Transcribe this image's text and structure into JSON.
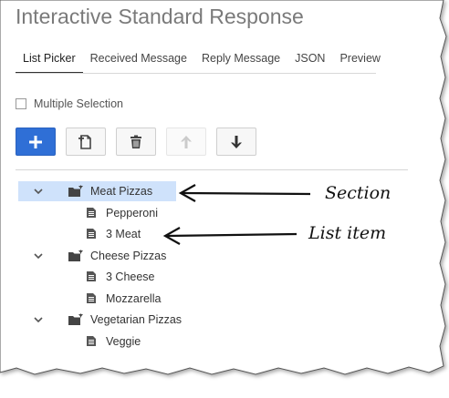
{
  "title": "Interactive Standard Response",
  "tabs": [
    "List Picker",
    "Received Message",
    "Reply Message",
    "JSON",
    "Preview"
  ],
  "active_tab": "List Picker",
  "multiple_selection_label": "Multiple Selection",
  "toolbar": {
    "add_icon": "plus-icon",
    "add_item_icon": "add-document-icon",
    "delete_icon": "trash-icon",
    "move_up_icon": "arrow-up-icon",
    "move_down_icon": "arrow-down-icon"
  },
  "tree": [
    {
      "section": "Meat Pizzas",
      "items": [
        "Pepperoni",
        "3 Meat"
      ]
    },
    {
      "section": "Cheese Pizzas",
      "items": [
        "3 Cheese",
        "Mozzarella"
      ]
    },
    {
      "section": "Vegetarian Pizzas",
      "items": [
        "Veggie"
      ]
    }
  ],
  "annotations": {
    "section": "Section",
    "list_item": "List item"
  },
  "colors": {
    "primary": "#2f6fd6",
    "selected_row": "#cfe2fb",
    "text": "#333333"
  }
}
